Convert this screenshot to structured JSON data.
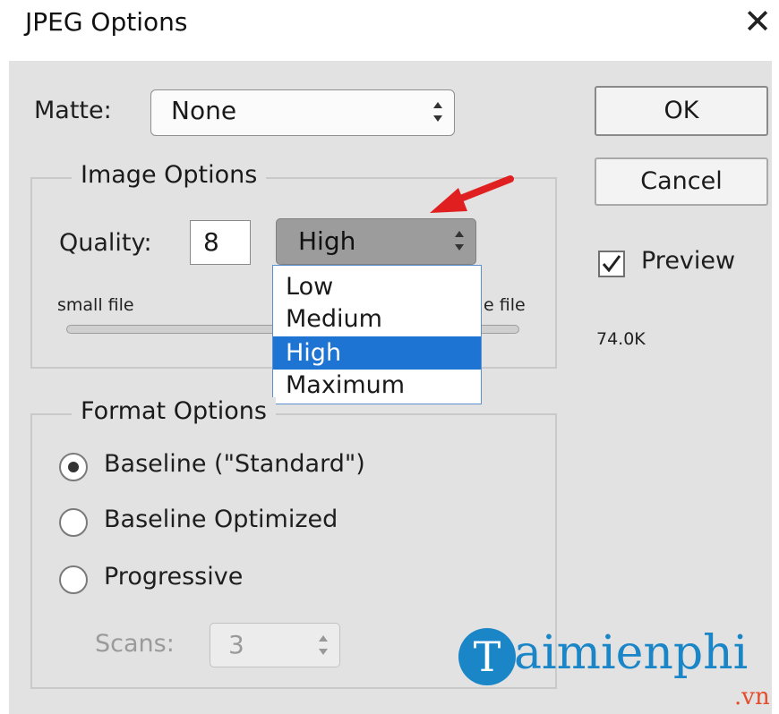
{
  "dialog": {
    "title": "JPEG Options"
  },
  "matte": {
    "label": "Matte:",
    "value": "None"
  },
  "image_options": {
    "legend": "Image Options",
    "quality_label": "Quality:",
    "quality_value": "8",
    "quality_preset": "High",
    "small_file_label": "small file",
    "large_file_label_visible": "e file",
    "preset_options": [
      "Low",
      "Medium",
      "High",
      "Maximum"
    ],
    "selected_option": "High"
  },
  "format_options": {
    "legend": "Format Options",
    "radios": [
      {
        "label": "Baseline (\"Standard\")",
        "checked": true
      },
      {
        "label": "Baseline Optimized",
        "checked": false
      },
      {
        "label": "Progressive",
        "checked": false
      }
    ],
    "scans_label": "Scans:",
    "scans_value": "3"
  },
  "buttons": {
    "ok": "OK",
    "cancel": "Cancel"
  },
  "preview": {
    "label": "Preview",
    "checked": true,
    "size": "74.0K"
  },
  "watermark": {
    "text": "aimienphi",
    "suffix": ".vn",
    "logo_letter": "T"
  },
  "colors": {
    "selection": "#1e74d2",
    "panel": "#e2e2e2",
    "arrow": "#e02020",
    "watermark": "#1a86c8"
  },
  "icons": {
    "close": "close-icon",
    "dropdown": "updown-arrows-icon",
    "annotation": "red-arrow-icon"
  }
}
